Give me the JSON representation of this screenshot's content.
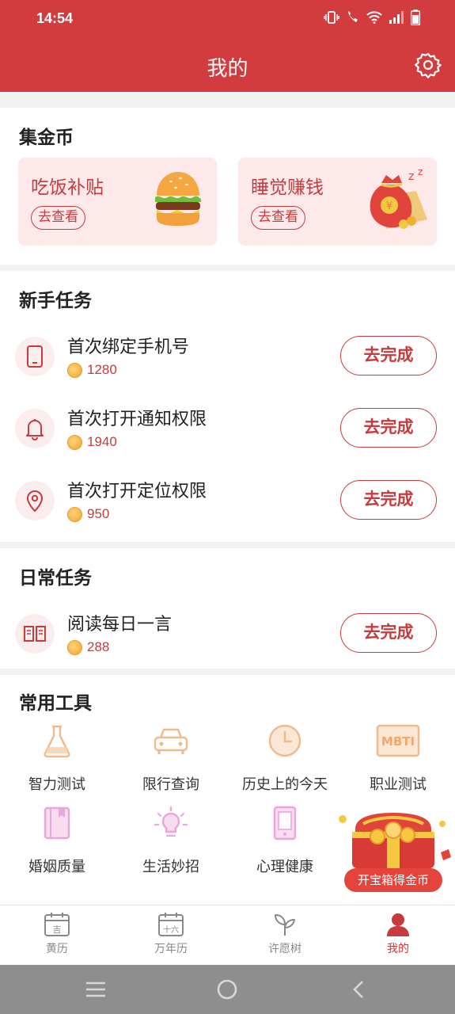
{
  "status_bar": {
    "time": "14:54"
  },
  "header": {
    "title": "我的",
    "settings_icon": "gear-icon"
  },
  "coins_section": {
    "title": "集金币",
    "cards": [
      {
        "title": "吃饭补贴",
        "button": "去查看",
        "art": "hamburger-icon"
      },
      {
        "title": "睡觉赚钱",
        "button": "去查看",
        "art": "money-bag-icon"
      }
    ]
  },
  "newbie_section": {
    "title": "新手任务",
    "tasks": [
      {
        "title": "首次绑定手机号",
        "reward": "1280",
        "button": "去完成",
        "icon": "phone-icon"
      },
      {
        "title": "首次打开通知权限",
        "reward": "1940",
        "button": "去完成",
        "icon": "bell-icon"
      },
      {
        "title": "首次打开定位权限",
        "reward": "950",
        "button": "去完成",
        "icon": "location-pin-icon"
      }
    ]
  },
  "daily_section": {
    "title": "日常任务",
    "tasks": [
      {
        "title": "阅读每日一言",
        "reward": "288",
        "button": "去完成",
        "icon": "book-icon"
      }
    ]
  },
  "tools_section": {
    "title": "常用工具",
    "tools": [
      {
        "label": "智力测试",
        "icon": "flask-icon"
      },
      {
        "label": "限行查询",
        "icon": "car-icon"
      },
      {
        "label": "历史上的今天",
        "icon": "clock-icon"
      },
      {
        "label": "职业测试",
        "icon": "mbti-icon",
        "icon_text": "MBTI"
      },
      {
        "label": "婚姻质量",
        "icon": "notebook-icon"
      },
      {
        "label": "生活妙招",
        "icon": "lightbulb-icon"
      },
      {
        "label": "心理健康",
        "icon": "tablet-icon"
      }
    ]
  },
  "treasure": {
    "label": "开宝箱得金币"
  },
  "bottom_nav": {
    "items": [
      {
        "label": "黄历",
        "icon": "calendar-ji-icon",
        "icon_text": "吉"
      },
      {
        "label": "万年历",
        "icon": "calendar-16-icon",
        "icon_text": "十六"
      },
      {
        "label": "许愿树",
        "icon": "sprout-icon"
      },
      {
        "label": "我的",
        "icon": "user-icon",
        "active": true
      }
    ]
  },
  "colors": {
    "primary": "#d23c3f",
    "accent_text": "#c73a3d",
    "promo_bg": "#fde9e9",
    "tool_orange": "#f2b98a",
    "tool_pink": "#e9a6d9"
  }
}
